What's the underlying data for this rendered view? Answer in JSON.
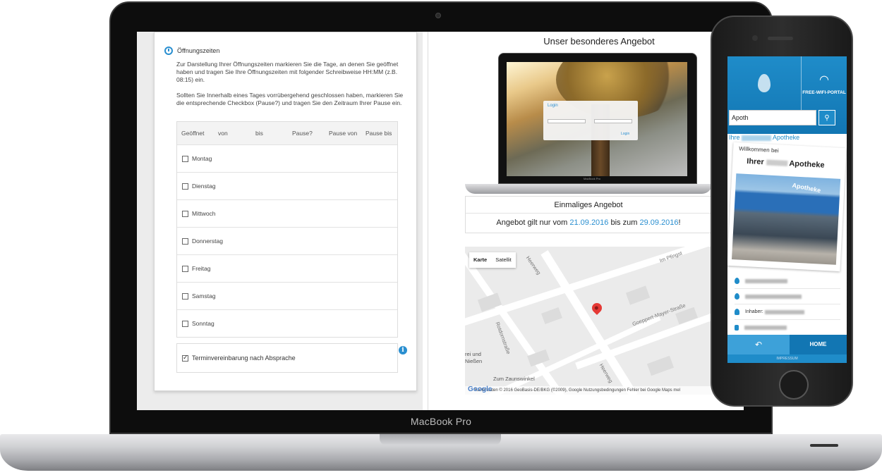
{
  "laptop": {
    "brand_label": "MacBook Pro"
  },
  "hours_form": {
    "section_title": "Öffnungszeiten",
    "description_1": "Zur Darstellung Ihrer Öffnungszeiten markieren Sie die Tage, an denen Sie geöffnet haben und tragen Sie Ihre Öffnungszeiten mit folgender Schreibweise HH:MM (z.B. 08:15) ein.",
    "description_2": "Sollten Sie Innerhalb eines Tages vorrübergehend geschlossen haben, markieren Sie die entsprechende Checkbox (Pause?) und tragen Sie den Zeitraum Ihrer Pause ein.",
    "columns": [
      "Geöffnet",
      "von",
      "bis",
      "Pause?",
      "Pause von",
      "Pause bis"
    ],
    "days": [
      "Montag",
      "Dienstag",
      "Mittwoch",
      "Donnerstag",
      "Freitag",
      "Samstag",
      "Sonntag"
    ],
    "appointment_label": "Terminvereinbarung nach Absprache",
    "appointment_checked": true
  },
  "offer": {
    "title": "Unser besonderes Angebot",
    "mini_login_title": "Login",
    "mini_login_button": "Login",
    "mini_brand": "MacBook Pro",
    "subtitle": "Einmaliges Angebot",
    "valid_prefix": "Angebot gilt nur vom",
    "date_from": "21.09.2016",
    "valid_middle": "bis zum",
    "date_to": "29.09.2016",
    "valid_suffix": "!"
  },
  "map": {
    "tab_map": "Karte",
    "tab_satellite": "Satellit",
    "streets": [
      "Heerweg",
      "Rotdornstraße",
      "Goeppert-Mayer-Straße",
      "Im Pfingst",
      "Heerweg"
    ],
    "pois": [
      "rei und",
      "Nießen",
      "Zum Zaunswinkel"
    ],
    "google": "Google",
    "footer": "Kartendaten © 2016 GeoBasis-DE/BKG (©2009), Google   Nutzungsbedingungen   Fehler bei Google Maps mel"
  },
  "phone": {
    "logo_text": "",
    "wifi_label": "FREE-WIFI-PORTAL",
    "search_value": "Apoth",
    "search_icon": "search-icon",
    "pharmacy_title": "Ihre",
    "pharmacy_title_end": "Apotheke",
    "welcome_line1": "Willkommen bei",
    "welcome_line2": "Ihrer",
    "welcome_line2_end": "Apotheke",
    "store_sign": "Apotheke",
    "info_owner_prefix": "Inhaber:",
    "nav_home": "HOME",
    "nav_back_icon": "back-arrow-icon",
    "footer": "IMPRESSUM"
  }
}
